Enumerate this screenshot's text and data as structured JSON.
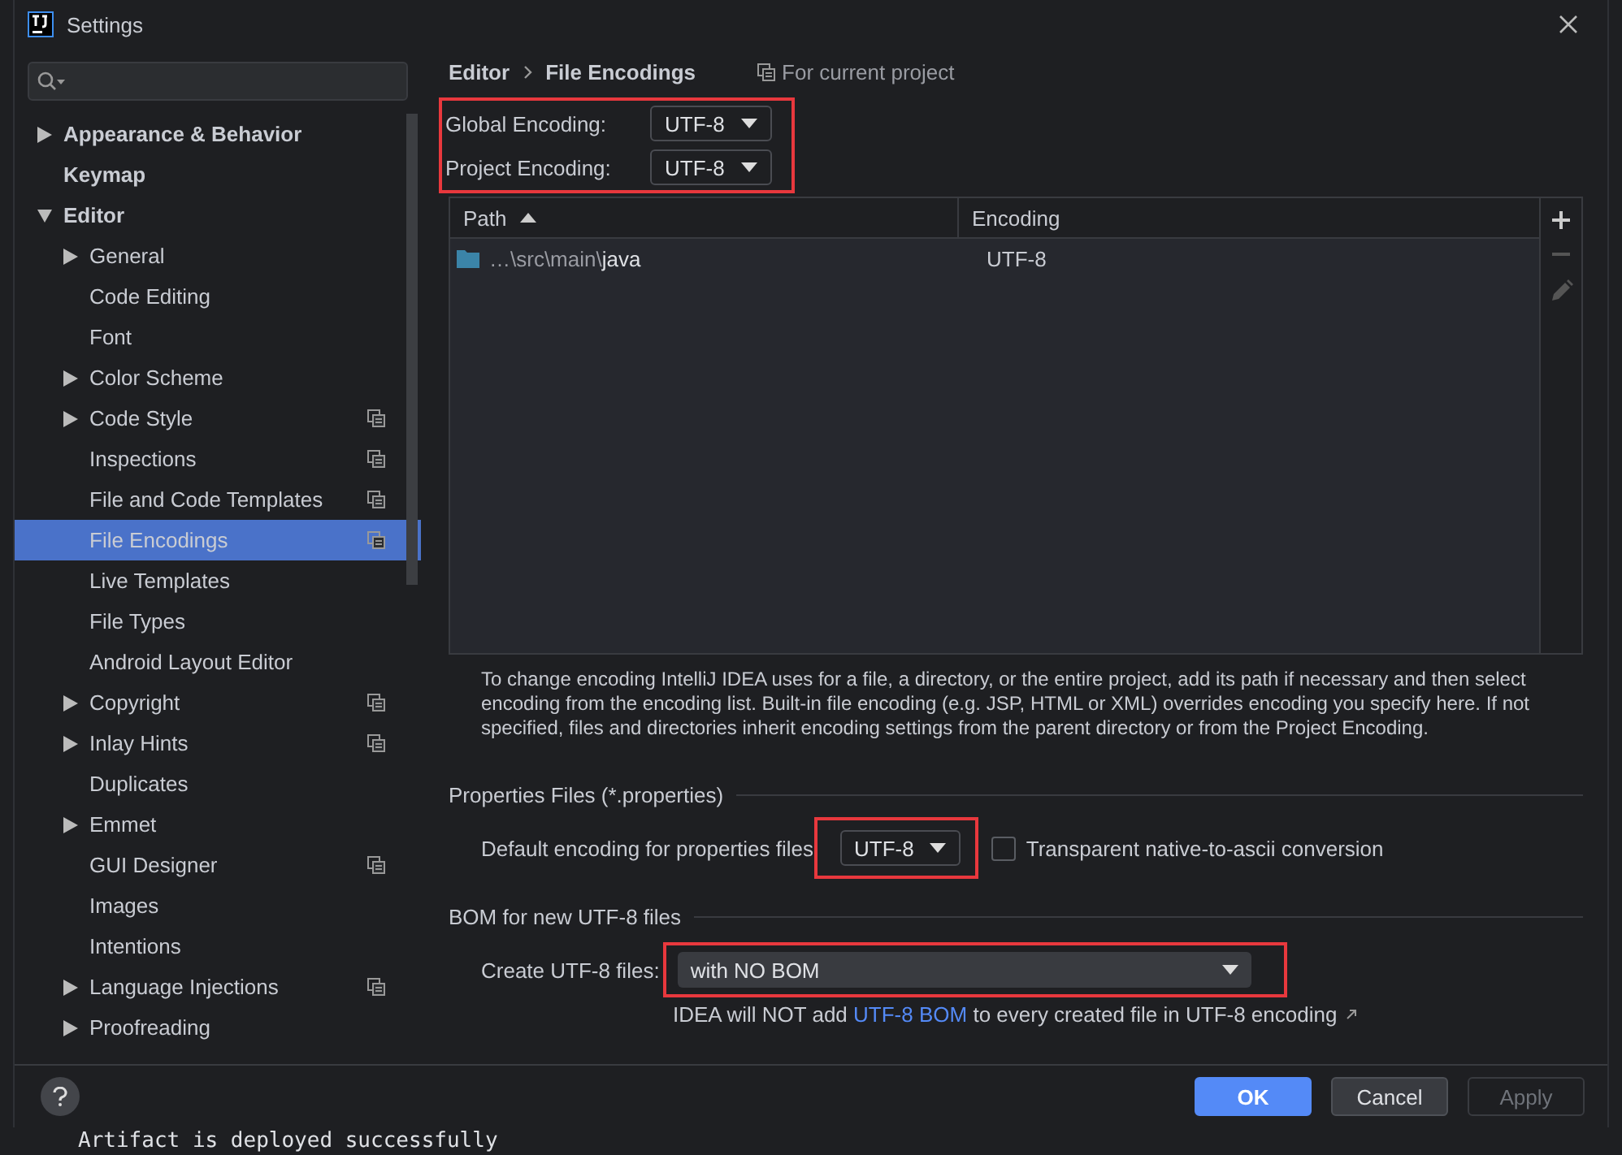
{
  "window": {
    "title": "Settings"
  },
  "sidebar": {
    "items": [
      {
        "label": "Appearance & Behavior",
        "kind": "folder",
        "expanded": false,
        "selected": false,
        "project_scoped": false,
        "bold": true
      },
      {
        "label": "Keymap",
        "kind": "page",
        "selected": false,
        "project_scoped": false,
        "bold": true
      },
      {
        "label": "Editor",
        "kind": "folder",
        "expanded": true,
        "selected": false,
        "project_scoped": false,
        "bold": true,
        "children": [
          {
            "label": "General",
            "kind": "folder",
            "expanded": false,
            "selected": false,
            "project_scoped": false
          },
          {
            "label": "Code Editing",
            "kind": "page",
            "selected": false,
            "project_scoped": false
          },
          {
            "label": "Font",
            "kind": "page",
            "selected": false,
            "project_scoped": false
          },
          {
            "label": "Color Scheme",
            "kind": "folder",
            "expanded": false,
            "selected": false,
            "project_scoped": false
          },
          {
            "label": "Code Style",
            "kind": "folder",
            "expanded": false,
            "selected": false,
            "project_scoped": true
          },
          {
            "label": "Inspections",
            "kind": "page",
            "selected": false,
            "project_scoped": true
          },
          {
            "label": "File and Code Templates",
            "kind": "page",
            "selected": false,
            "project_scoped": true
          },
          {
            "label": "File Encodings",
            "kind": "page",
            "selected": true,
            "project_scoped": true
          },
          {
            "label": "Live Templates",
            "kind": "page",
            "selected": false,
            "project_scoped": false
          },
          {
            "label": "File Types",
            "kind": "page",
            "selected": false,
            "project_scoped": false
          },
          {
            "label": "Android Layout Editor",
            "kind": "page",
            "selected": false,
            "project_scoped": false
          },
          {
            "label": "Copyright",
            "kind": "folder",
            "expanded": false,
            "selected": false,
            "project_scoped": true
          },
          {
            "label": "Inlay Hints",
            "kind": "folder",
            "expanded": false,
            "selected": false,
            "project_scoped": true
          },
          {
            "label": "Duplicates",
            "kind": "page",
            "selected": false,
            "project_scoped": false
          },
          {
            "label": "Emmet",
            "kind": "folder",
            "expanded": false,
            "selected": false,
            "project_scoped": false
          },
          {
            "label": "GUI Designer",
            "kind": "page",
            "selected": false,
            "project_scoped": true
          },
          {
            "label": "Images",
            "kind": "page",
            "selected": false,
            "project_scoped": false
          },
          {
            "label": "Intentions",
            "kind": "page",
            "selected": false,
            "project_scoped": false
          },
          {
            "label": "Language Injections",
            "kind": "folder",
            "expanded": false,
            "selected": false,
            "project_scoped": true
          },
          {
            "label": "Proofreading",
            "kind": "folder",
            "expanded": false,
            "selected": false,
            "project_scoped": false
          }
        ]
      }
    ]
  },
  "breadcrumb": [
    "Editor",
    "File Encodings"
  ],
  "scope_note": "For current project",
  "encodings": [
    {
      "label": "Global Encoding:",
      "value": "UTF-8"
    },
    {
      "label": "Project Encoding:",
      "value": "UTF-8"
    }
  ],
  "table": {
    "columns": [
      {
        "label": "Path",
        "sorted": true
      },
      {
        "label": "Encoding",
        "sorted": false
      }
    ],
    "rows": [
      {
        "path_prefix": "…\\src\\main\\",
        "path_name": "java",
        "encoding": "UTF-8"
      }
    ]
  },
  "description": "To change encoding IntelliJ IDEA uses for a file, a directory, or the entire project, add its path if necessary and then select encoding from the encoding list. Built-in file encoding (e.g. JSP, HTML or XML) overrides encoding you specify here. If not specified, files and directories inherit encoding settings from the parent directory or from the Project Encoding.",
  "properties": {
    "title": "Properties Files (*.properties)",
    "label": "Default encoding for properties files",
    "value": "UTF-8",
    "checkbox": {
      "label": "Transparent native-to-ascii conversion",
      "checked": false
    }
  },
  "bom": {
    "title": "BOM for new UTF-8 files",
    "label": "Create UTF-8 files:",
    "value": "with NO BOM",
    "hint_before": "IDEA will NOT add ",
    "hint_link": "UTF-8 BOM",
    "hint_after": " to every created file in UTF-8 encoding"
  },
  "buttons": [
    {
      "label": "OK",
      "kind": "primary",
      "disabled": false
    },
    {
      "label": "Cancel",
      "kind": "normal",
      "disabled": false
    },
    {
      "label": "Apply",
      "kind": "normal",
      "disabled": true
    }
  ],
  "background": {
    "console_line": "Artifact is deployed successfully"
  }
}
